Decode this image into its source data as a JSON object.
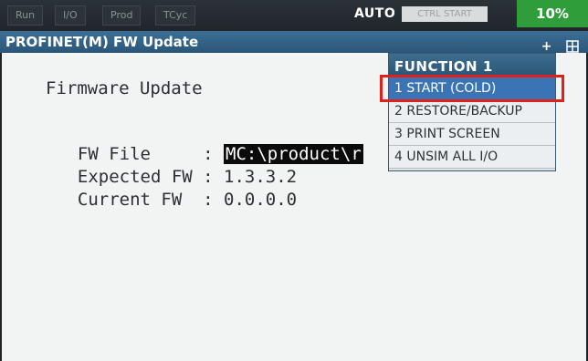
{
  "status_bar": {
    "indicators": [
      "Run",
      "I/O",
      "Prod",
      "TCyc"
    ],
    "mode": "AUTO",
    "control": "CTRL START",
    "percent": "10%"
  },
  "title_bar": {
    "title": "PROFINET(M) FW Update",
    "icons": [
      "plus-icon",
      "window-layout-icon"
    ]
  },
  "screen": {
    "heading": "Firmware Update",
    "rows": [
      {
        "label": "FW File     : ",
        "value": "MC:\\product\\r"
      },
      {
        "label": "Expected FW : ",
        "value": "1.3.3.2"
      },
      {
        "label": "Current FW  : ",
        "value": "0.0.0.0"
      }
    ]
  },
  "function_menu": {
    "header": "FUNCTION  1",
    "items": [
      "1 START (COLD)",
      "2 RESTORE/BACKUP",
      "3 PRINT SCREEN",
      "4 UNSIM ALL I/O"
    ],
    "selected_index": 0
  },
  "colors": {
    "title_bar": "#2b5678",
    "selected_item": "#3a74b4",
    "highlight_box": "#e0201a",
    "percent_badge": "#2f9e3a"
  }
}
